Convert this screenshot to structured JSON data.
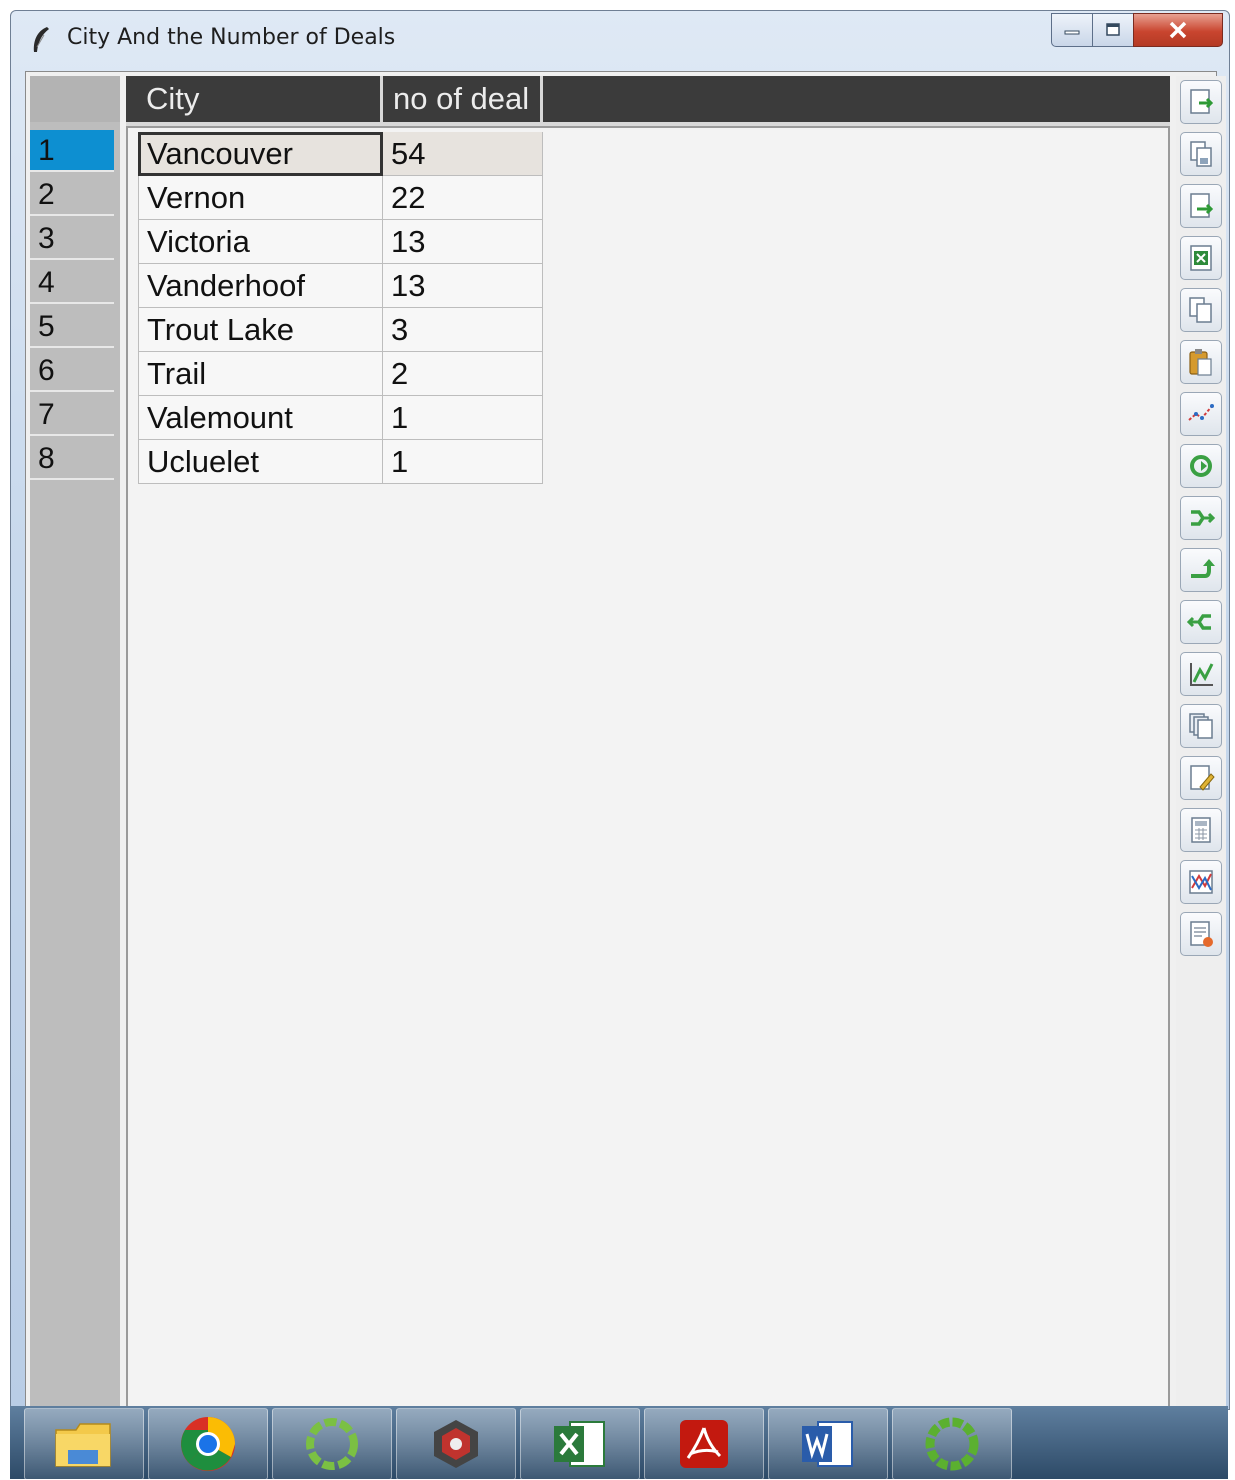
{
  "window": {
    "title": "City And the Number of Deals",
    "buttons": [
      "minimize",
      "maximize",
      "close"
    ]
  },
  "table": {
    "columns": [
      "City",
      "no of deal"
    ],
    "row_numbers": [
      "1",
      "2",
      "3",
      "4",
      "5",
      "6",
      "7",
      "8"
    ],
    "selected_row": 1,
    "rows": [
      {
        "city": "Vancouver",
        "deals": "54"
      },
      {
        "city": "Vernon",
        "deals": "22"
      },
      {
        "city": "Victoria",
        "deals": "13"
      },
      {
        "city": "Vanderhoof",
        "deals": "13"
      },
      {
        "city": "Trout Lake",
        "deals": "3"
      },
      {
        "city": "Trail",
        "deals": "2"
      },
      {
        "city": "Valemount",
        "deals": "1"
      },
      {
        "city": "Ucluelet",
        "deals": "1"
      }
    ]
  },
  "toolbar": {
    "icons": [
      "import-icon",
      "save-icon",
      "export-icon",
      "excel-export-icon",
      "copy-icon",
      "paste-icon",
      "plot-icon",
      "refresh-icon",
      "merge-icon",
      "undo-icon",
      "split-icon",
      "chart-icon",
      "duplicate-icon",
      "edit-file-icon",
      "calculator-icon",
      "graph-icon",
      "report-icon"
    ]
  },
  "taskbar": {
    "apps": [
      "file-explorer-icon",
      "chrome-icon",
      "green-ring-app-icon",
      "spider-app-icon",
      "excel-icon",
      "acrobat-icon",
      "word-icon",
      "green-ring-app-icon-2"
    ]
  },
  "colors": {
    "header_bg": "#3b3b3b",
    "selected_row": "#0d8fd1",
    "active_row_bg": "#e7e3de"
  }
}
